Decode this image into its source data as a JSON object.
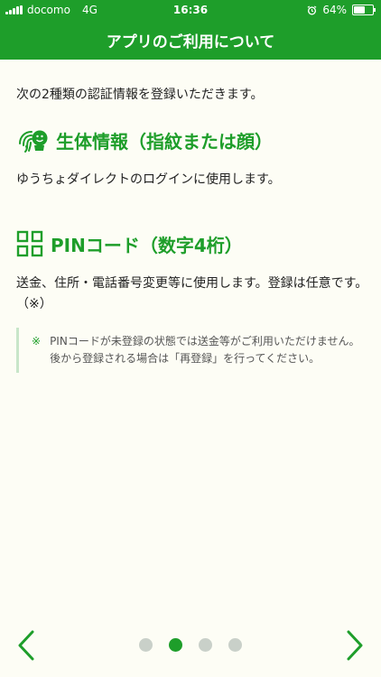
{
  "status": {
    "carrier": "docomo",
    "network": "4G",
    "time": "16:36",
    "battery": "64%",
    "battery_level": 0.64
  },
  "nav": {
    "title": "アプリのご利用について"
  },
  "content": {
    "intro": "次の2種類の認証情報を登録いただきます。",
    "biometric": {
      "icon": "face-fingerprint-icon",
      "title": "生体情報（指紋または顔）",
      "desc": "ゆうちょダイレクトのログインに使用します。"
    },
    "pin": {
      "icon": "pin-grid-icon",
      "title": "PINコード（数字4桁）",
      "desc": "送金、住所・電話番号変更等に使用します。登録は任意です。（※）"
    },
    "note": {
      "mark": "※",
      "text": "PINコードが未登録の状態では送金等がご利用いただけません。後から登録される場合は「再登録」を行ってください。"
    }
  },
  "pager": {
    "current": 2,
    "total": 4
  },
  "colors": {
    "brand": "#1e9e2a",
    "background": "#fdfdf5"
  }
}
